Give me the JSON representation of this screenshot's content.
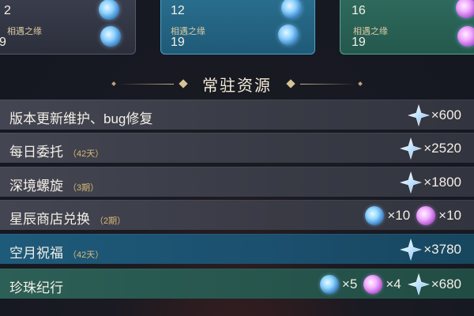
{
  "colors": {
    "primogem": "#bfe3ff",
    "highlight_row": "#1e5a7a",
    "green_row": "#2c5f56",
    "accent_gold": "#d8b877"
  },
  "top_cards": [
    {
      "value": "2",
      "subtitle": "相遇之缘"
    },
    {
      "value": "12",
      "subtitle": "相遇之缘"
    },
    {
      "value": "16",
      "subtitle": "相遇之缘"
    }
  ],
  "top_values_bottom": [
    "9",
    "19",
    "19"
  ],
  "section": {
    "title": "常驻资源"
  },
  "rows": [
    {
      "label": "版本更新维护、bug修复",
      "tag": "",
      "rewards": [
        {
          "icon": "primogem-icon",
          "qty": "×600"
        }
      ]
    },
    {
      "label": "每日委托",
      "tag": "（42天）",
      "rewards": [
        {
          "icon": "primogem-icon",
          "qty": "×2520"
        }
      ]
    },
    {
      "label": "深境螺旋",
      "tag": "（3期）",
      "rewards": [
        {
          "icon": "primogem-icon",
          "qty": "×1800"
        }
      ]
    },
    {
      "label": "星辰商店兑换",
      "tag": "（2期）",
      "rewards": [
        {
          "icon": "acquaint-fate-icon",
          "qty": "×10"
        },
        {
          "icon": "intertwined-fate-icon",
          "qty": "×10"
        }
      ]
    },
    {
      "label": "空月祝福",
      "tag": "（42天）",
      "rewards": [
        {
          "icon": "primogem-icon",
          "qty": "×3780"
        }
      ]
    },
    {
      "label": "珍珠纪行",
      "tag": "",
      "rewards": [
        {
          "icon": "acquaint-fate-icon",
          "qty": "×5"
        },
        {
          "icon": "intertwined-fate-icon",
          "qty": "×4"
        },
        {
          "icon": "primogem-icon",
          "qty": "×680"
        }
      ]
    }
  ]
}
